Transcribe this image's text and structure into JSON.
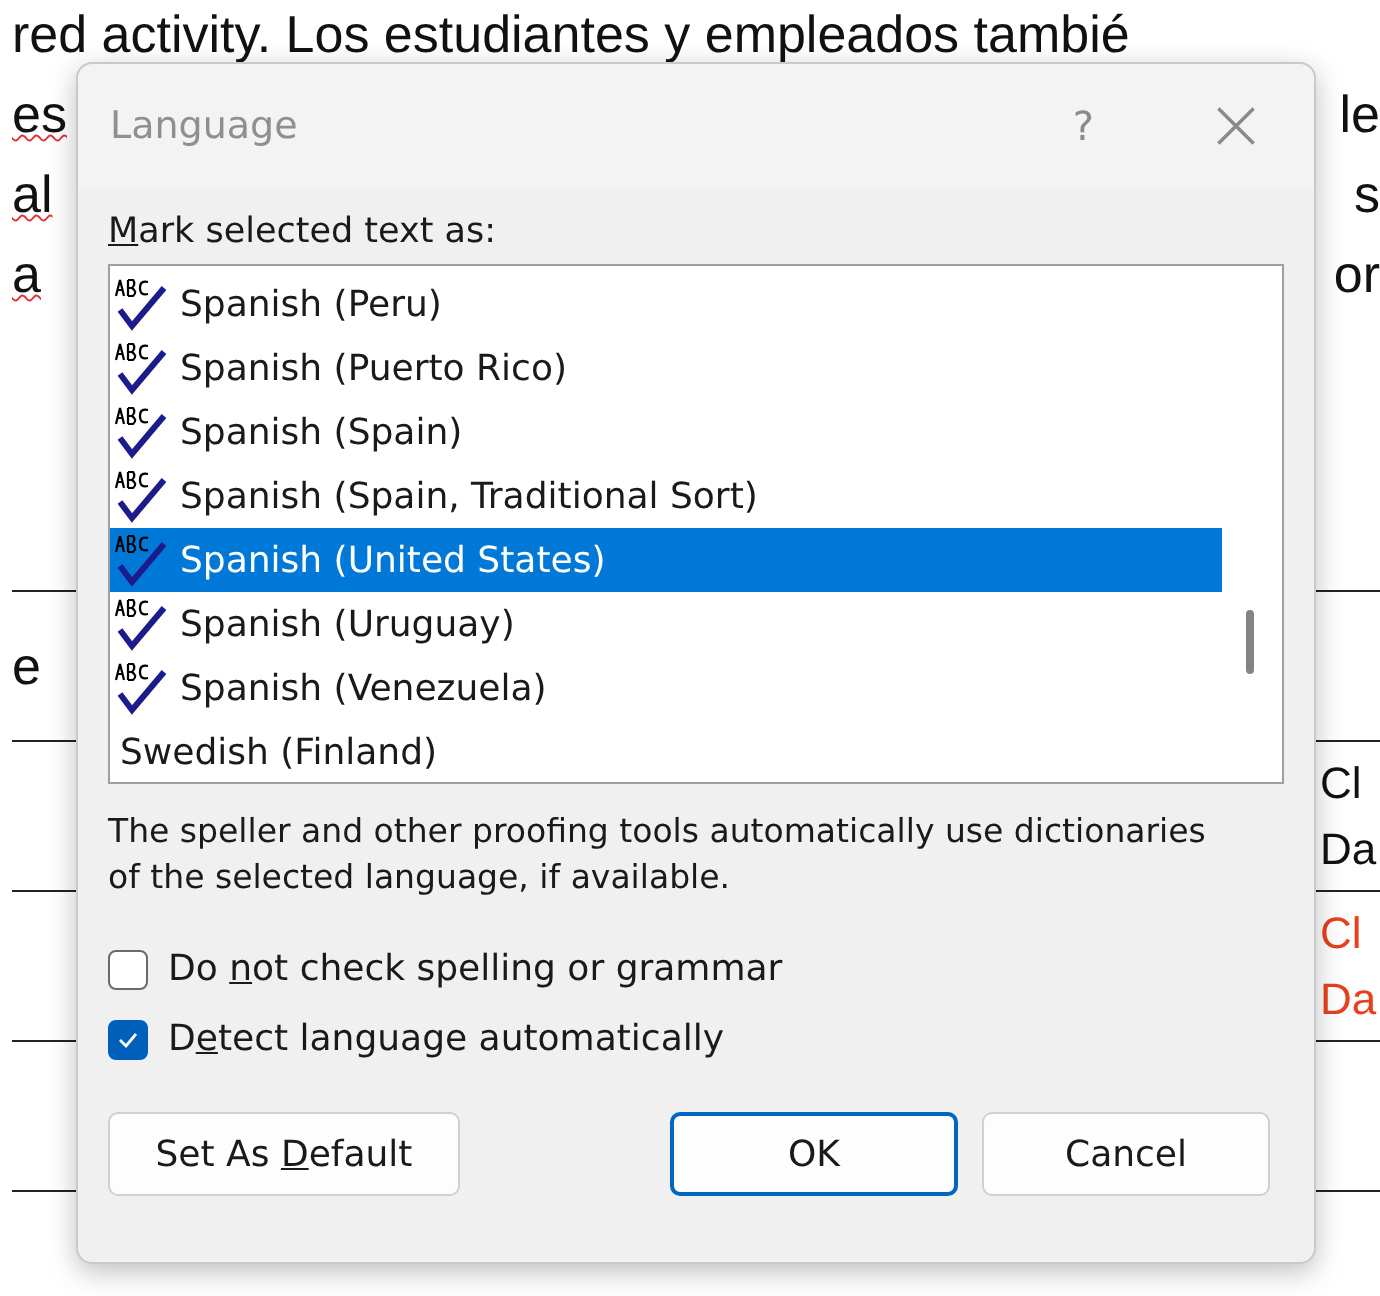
{
  "document": {
    "top_line": "red activity. Los estudiantes y empleados tambié",
    "lines": [
      {
        "left": "es",
        "right": "le"
      },
      {
        "left": "al",
        "right": "s"
      },
      {
        "left": "a",
        "right": "or"
      }
    ],
    "table_rows": [
      {
        "left": "e",
        "red": false
      },
      {
        "right": [
          "Cl",
          "Da"
        ],
        "red": false
      },
      {
        "right": [
          "Cl",
          "Da"
        ],
        "red": true
      },
      {}
    ]
  },
  "dialog": {
    "title": "Language",
    "help": "?",
    "list_label": {
      "access_key": "M",
      "text_after": "ark selected text as:"
    },
    "languages": [
      {
        "name": "Spanish (Peru)",
        "proofing": true,
        "selected": false
      },
      {
        "name": "Spanish (Puerto Rico)",
        "proofing": true,
        "selected": false
      },
      {
        "name": "Spanish (Spain)",
        "proofing": true,
        "selected": false
      },
      {
        "name": "Spanish (Spain, Traditional Sort)",
        "proofing": true,
        "selected": false
      },
      {
        "name": "Spanish (United States)",
        "proofing": true,
        "selected": true
      },
      {
        "name": "Spanish (Uruguay)",
        "proofing": true,
        "selected": false
      },
      {
        "name": "Spanish (Venezuela)",
        "proofing": true,
        "selected": false
      },
      {
        "name": "Swedish (Finland)",
        "proofing": false,
        "selected": false
      }
    ],
    "info": "The speller and other proofing tools automatically use dictionaries of the selected language, if available.",
    "options": [
      {
        "text_before": "Do ",
        "access_key": "n",
        "text_after": "ot check spelling or grammar",
        "checked": false
      },
      {
        "text_before": "D",
        "access_key": "e",
        "text_after": "tect language automatically",
        "checked": true
      }
    ],
    "buttons": [
      {
        "text_before": "Set As ",
        "access_key": "D",
        "text_after": "efault",
        "primary": false
      },
      {
        "text_before": "OK",
        "primary": true
      },
      {
        "text_before": "Cancel",
        "primary": false
      }
    ]
  }
}
